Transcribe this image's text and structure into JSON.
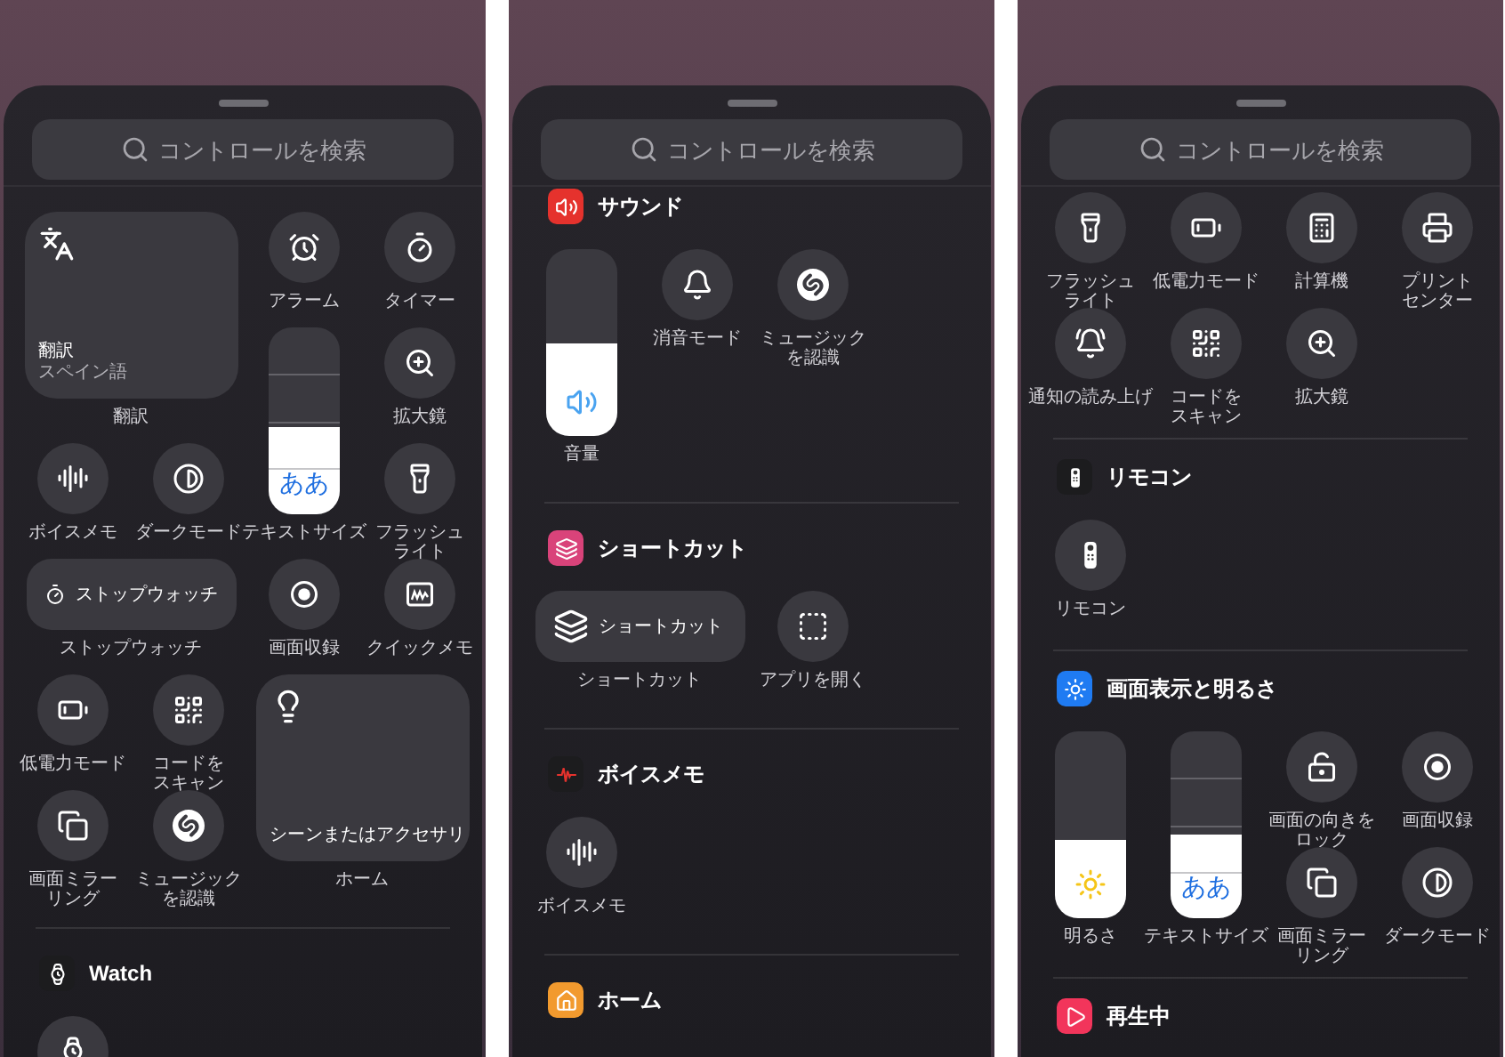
{
  "panels": [
    {
      "search": {
        "placeholder": "コントロールを検索"
      },
      "sections": [
        {
          "items": [
            {
              "kind": "tile",
              "text": "翻訳",
              "subtext": "スペイン語",
              "label": "翻訳"
            },
            {
              "kind": "circle",
              "label": "アラーム"
            },
            {
              "kind": "circle",
              "label": "タイマー"
            },
            {
              "kind": "slider",
              "text": "ああ",
              "level": 0.47,
              "label": "テキストサイズ"
            },
            {
              "kind": "circle",
              "label": "拡大鏡"
            },
            {
              "kind": "circle",
              "label": "ボイスメモ"
            },
            {
              "kind": "circle",
              "label": "ダークモード"
            },
            {
              "kind": "circle",
              "label": "フラッシュライト"
            },
            {
              "kind": "pill",
              "text": "ストップウォッチ",
              "label": "ストップウォッチ"
            },
            {
              "kind": "circle",
              "label": "画面収録"
            },
            {
              "kind": "circle",
              "label": "クイックメモ"
            },
            {
              "kind": "circle",
              "label": "低電力モード"
            },
            {
              "kind": "circle",
              "label": "コードをスキャン"
            },
            {
              "kind": "circle",
              "label": "画面ミラーリング"
            },
            {
              "kind": "circle",
              "label": "ミュージックを認識"
            },
            {
              "kind": "tile",
              "text": "シーンまたはアクセサリ",
              "label": "ホーム"
            }
          ]
        },
        {
          "header": {
            "title": "Watch",
            "color": "#1c1c1e"
          },
          "items": [
            {
              "kind": "circle"
            }
          ]
        }
      ]
    },
    {
      "search": {
        "placeholder": "コントロールを検索"
      },
      "sections": [
        {
          "header": {
            "title": "サウンド",
            "color": "#e5322d"
          },
          "items": [
            {
              "kind": "slider",
              "level": 0.5,
              "label": "音量"
            },
            {
              "kind": "circle",
              "label": "消音モード"
            },
            {
              "kind": "circle",
              "label": "ミュージックを認識"
            }
          ]
        },
        {
          "header": {
            "title": "ショートカット",
            "color": "#d9437a"
          },
          "items": [
            {
              "kind": "pill",
              "text": "ショートカット",
              "label": "ショートカット"
            },
            {
              "kind": "circle",
              "label": "アプリを開く"
            }
          ]
        },
        {
          "header": {
            "title": "ボイスメモ",
            "color": "#1c1c1e"
          },
          "items": [
            {
              "kind": "circle",
              "label": "ボイスメモ"
            }
          ]
        },
        {
          "header": {
            "title": "ホーム",
            "color": "#f29a2e"
          }
        }
      ]
    },
    {
      "search": {
        "placeholder": "コントロールを検索"
      },
      "sections": [
        {
          "items": [
            {
              "kind": "circle",
              "label": "フラッシュライト"
            },
            {
              "kind": "circle",
              "label": "低電力モード"
            },
            {
              "kind": "circle",
              "label": "計算機"
            },
            {
              "kind": "circle",
              "label": "プリントセンター"
            },
            {
              "kind": "circle",
              "label": "通知の読み上げ"
            },
            {
              "kind": "circle",
              "label": "コードをスキャン"
            },
            {
              "kind": "circle",
              "label": "拡大鏡"
            }
          ]
        },
        {
          "header": {
            "title": "リモコン",
            "color": "#1c1c1e"
          },
          "items": [
            {
              "kind": "circle",
              "label": "リモコン"
            }
          ]
        },
        {
          "header": {
            "title": "画面表示と明るさ",
            "color": "#1f7bf2"
          },
          "items": [
            {
              "kind": "slider",
              "level": 0.42,
              "label": "明るさ"
            },
            {
              "kind": "slider",
              "text": "ああ",
              "level": 0.45,
              "label": "テキストサイズ"
            },
            {
              "kind": "circle",
              "label": "画面の向きをロック"
            },
            {
              "kind": "circle",
              "label": "画面収録"
            },
            {
              "kind": "circle",
              "label": "画面ミラーリング"
            },
            {
              "kind": "circle",
              "label": "ダークモード"
            }
          ]
        },
        {
          "header": {
            "title": "再生中",
            "color": "#f2355b"
          }
        }
      ]
    }
  ]
}
